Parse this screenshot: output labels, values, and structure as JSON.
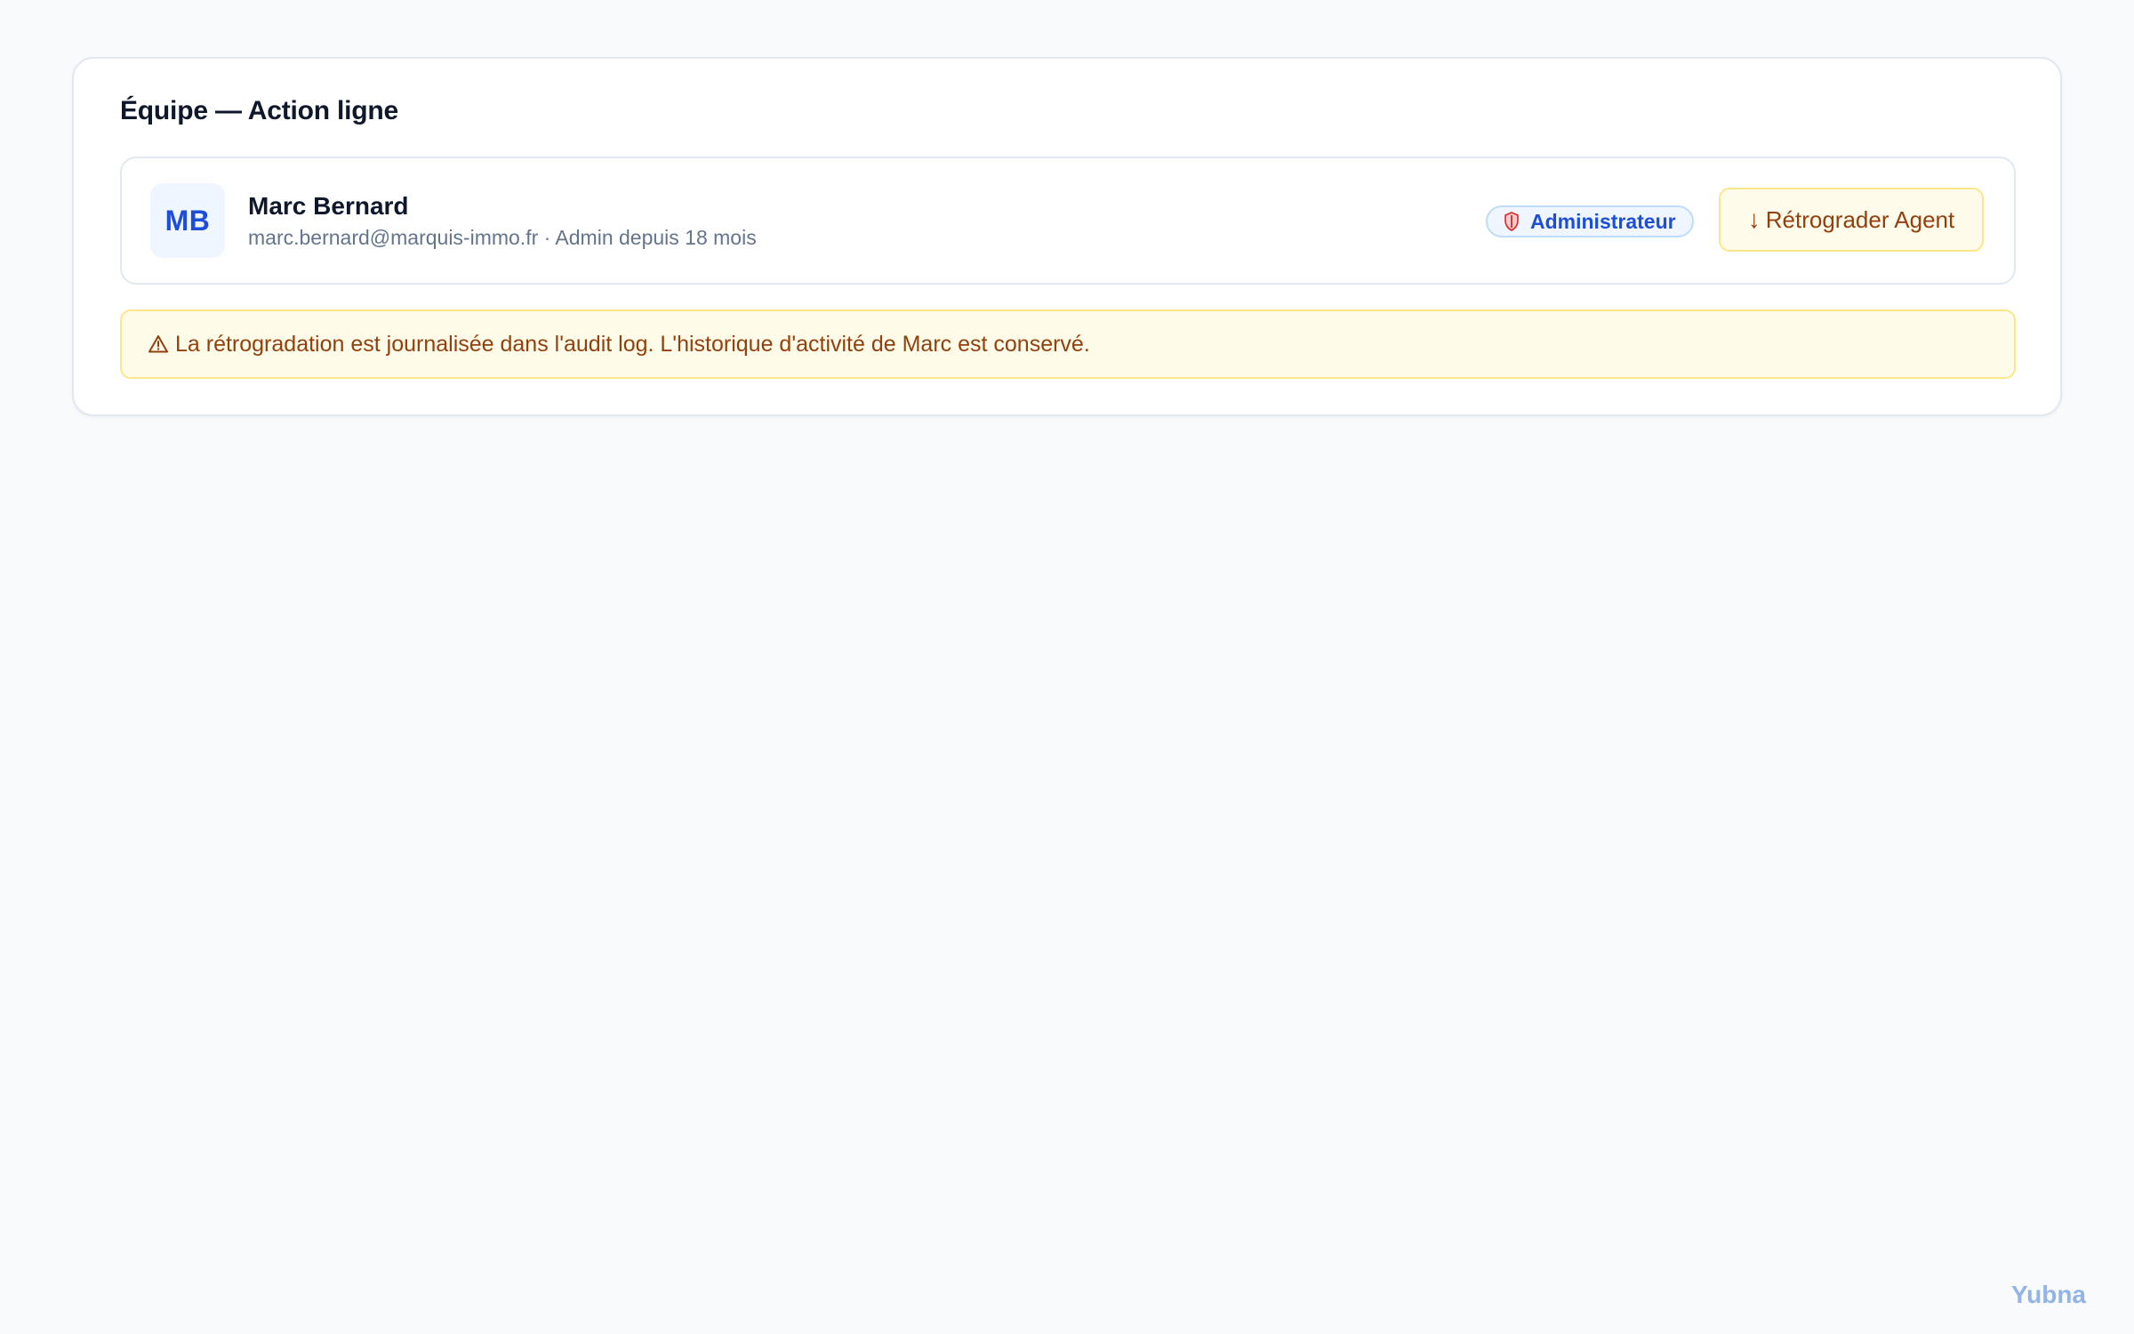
{
  "card": {
    "title": "Équipe — Action ligne"
  },
  "member": {
    "initials": "MB",
    "name": "Marc Bernard",
    "meta": "marc.bernard@marquis-immo.fr · Admin depuis 18 mois",
    "role_badge": {
      "label": "Administrateur",
      "icon": "shield-icon"
    },
    "demote_button": {
      "arrow": "↓",
      "label": "Rétrograder Agent"
    }
  },
  "notice": {
    "icon": "warning-icon",
    "text": "La rétrogradation est journalisée dans l'audit log. L'historique d'activité de Marc est conservé."
  },
  "watermark": "Yubna",
  "colors": {
    "accent": "#1d4ed8",
    "warning_text": "#92400e",
    "warning_border": "#fde68a",
    "warning_bg": "#fefce8",
    "badge_bg": "#eff6ff",
    "badge_border": "#bfdbfe",
    "page_bg": "#f8fafc"
  }
}
